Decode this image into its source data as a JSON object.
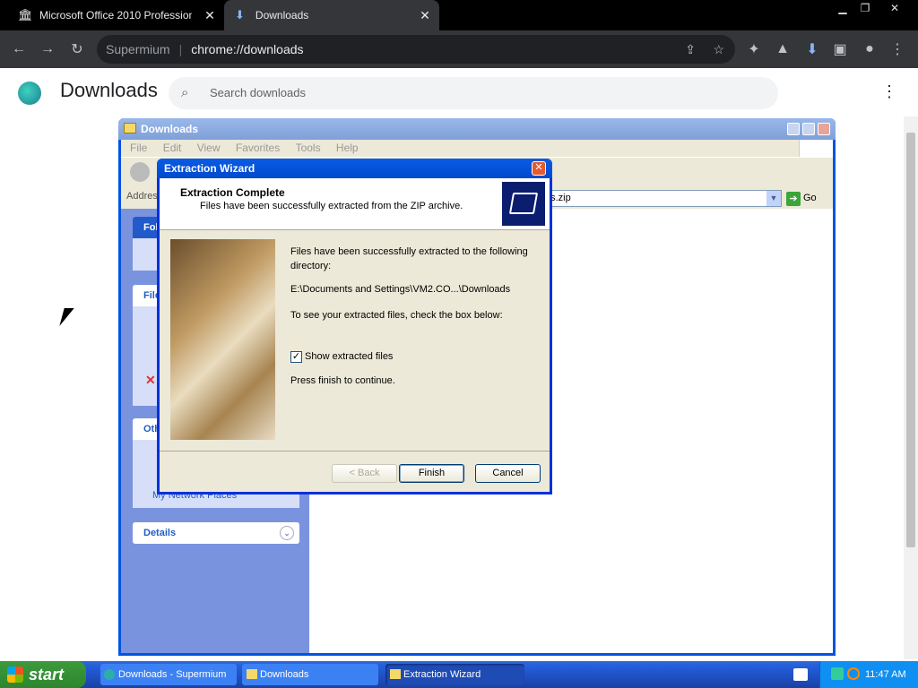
{
  "browser": {
    "tabs": [
      {
        "label": "Microsoft Office 2010 Professional P"
      },
      {
        "label": "Downloads"
      }
    ],
    "address": {
      "brand": "Supermium",
      "url": "chrome://downloads"
    }
  },
  "downloads_page": {
    "title": "Downloads",
    "search_placeholder": "Search downloads"
  },
  "explorer": {
    "title": "Downloads",
    "menu": [
      "File",
      "Edit",
      "View",
      "Favorites",
      "Tools",
      "Help"
    ],
    "address_label": "Address",
    "address_value": "ds.zip",
    "go_label": "Go",
    "tasks": {
      "folder_tasks": "Fol",
      "file_tasks": "File",
      "other_places": "Oth",
      "network_places": "My Network Places",
      "details": "Details"
    }
  },
  "wizard": {
    "title": "Extraction Wizard",
    "header_title": "Extraction Complete",
    "header_sub": "Files have been successfully extracted from the ZIP archive.",
    "line1": "Files have been successfully extracted to the following directory:",
    "path": "E:\\Documents and Settings\\VM2.CO...\\Downloads",
    "line2": "To see your extracted files, check the box below:",
    "checkbox_label": "Show extracted files",
    "checkbox_checked": true,
    "line3": "Press finish to continue.",
    "buttons": {
      "back": "< Back",
      "finish": "Finish",
      "cancel": "Cancel"
    }
  },
  "taskbar": {
    "start": "start",
    "tasks": [
      "Downloads - Supermium",
      "Downloads",
      "Extraction Wizard"
    ],
    "clock": "11:47 AM"
  }
}
